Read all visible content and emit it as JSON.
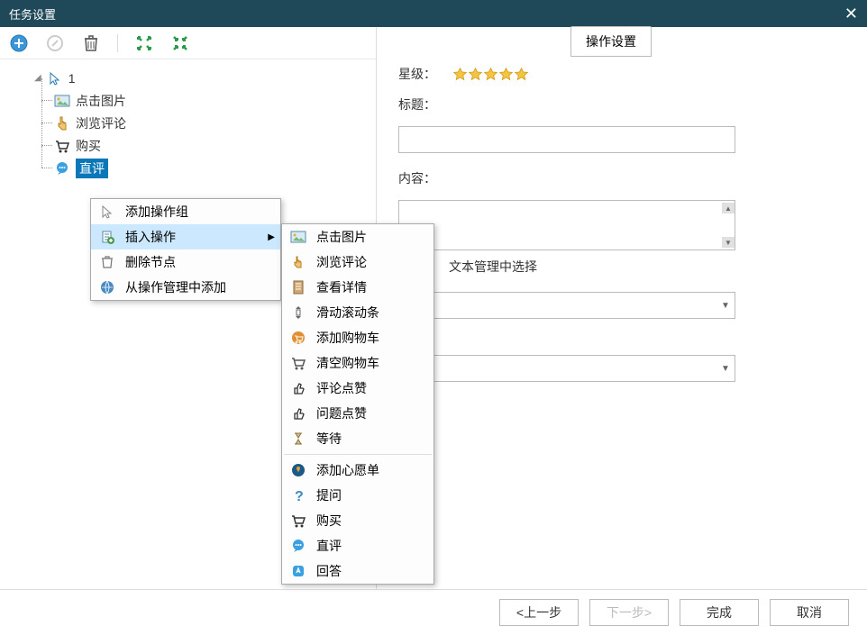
{
  "title": "任务设置",
  "toolbar_icons": [
    "add",
    "edit-disabled",
    "trash",
    "expand-full",
    "collapse"
  ],
  "tree": {
    "root": "1",
    "children": [
      {
        "icon": "image",
        "label": "点击图片"
      },
      {
        "icon": "pointer",
        "label": "浏览评论"
      },
      {
        "icon": "cart",
        "label": "购买"
      },
      {
        "icon": "chat",
        "label": "直评",
        "selected": true
      }
    ]
  },
  "context_menu": {
    "items": [
      {
        "icon": "cursor",
        "label": "添加操作组"
      },
      {
        "icon": "insert-doc",
        "label": "插入操作",
        "submenu": true,
        "active": true
      },
      {
        "icon": "trash",
        "label": "删除节点"
      },
      {
        "icon": "globe",
        "label": "从操作管理中添加"
      }
    ]
  },
  "submenu": {
    "groups": [
      [
        {
          "icon": "image",
          "label": "点击图片"
        },
        {
          "icon": "pointer",
          "label": "浏览评论"
        },
        {
          "icon": "detail",
          "label": "查看详情"
        },
        {
          "icon": "scroll",
          "label": "滑动滚动条"
        },
        {
          "icon": "addcart",
          "label": "添加购物车"
        },
        {
          "icon": "cart",
          "label": "清空购物车"
        },
        {
          "icon": "thumb",
          "label": "评论点赞"
        },
        {
          "icon": "thumb",
          "label": "问题点赞"
        },
        {
          "icon": "wait",
          "label": "等待"
        }
      ],
      [
        {
          "icon": "wish",
          "label": "添加心愿单"
        },
        {
          "icon": "question",
          "label": "提问"
        },
        {
          "icon": "cart-buy",
          "label": "购买"
        },
        {
          "icon": "chat",
          "label": "直评"
        },
        {
          "icon": "answer",
          "label": "回答"
        }
      ]
    ]
  },
  "right": {
    "tab": "操作设置",
    "star_label": "星级：",
    "star_count": 5,
    "title_label": "标题：",
    "content_label": "内容：",
    "hint_text": "文本管理中选择"
  },
  "buttons": {
    "prev": "<上一步",
    "next": "下一步>",
    "finish": "完成",
    "cancel": "取消"
  }
}
